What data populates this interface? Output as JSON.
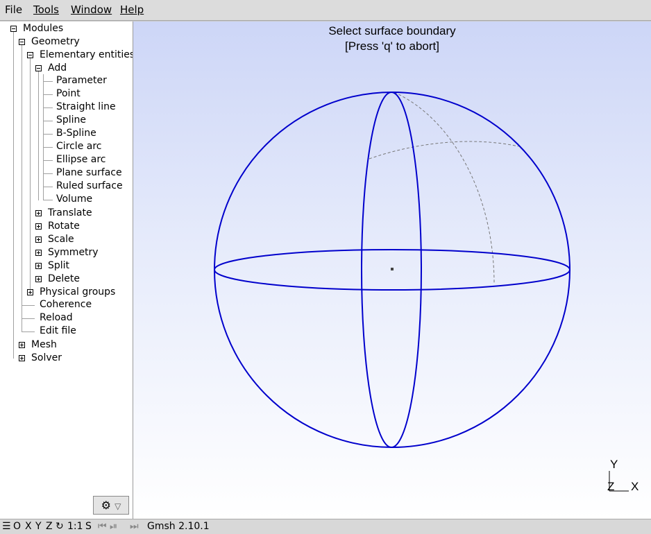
{
  "menu": {
    "file": "File",
    "tools": "Tools",
    "window": "Window",
    "help": "Help"
  },
  "tree": {
    "modules": "Modules",
    "geometry": "Geometry",
    "elementary": "Elementary entities",
    "add": "Add",
    "add_items": [
      "Parameter",
      "Point",
      "Straight line",
      "Spline",
      "B-Spline",
      "Circle arc",
      "Ellipse arc",
      "Plane surface",
      "Ruled surface",
      "Volume"
    ],
    "elementary_items": [
      "Translate",
      "Rotate",
      "Scale",
      "Symmetry",
      "Split",
      "Delete"
    ],
    "physical_groups": "Physical groups",
    "coherence": "Coherence",
    "reload": "Reload",
    "edit_file": "Edit file",
    "mesh": "Mesh",
    "solver": "Solver"
  },
  "viewport": {
    "prompt_line1": "Select surface boundary",
    "prompt_line2": "[Press 'q' to abort]",
    "axis_y": "Y",
    "axis_z": "Z",
    "axis_x": "X",
    "curve_color": "#0000cc"
  },
  "status": {
    "o": "O",
    "x": "X",
    "y": "Y",
    "z": "Z",
    "scale": "1:1",
    "s": "S",
    "app": "Gmsh 2.10.1"
  }
}
